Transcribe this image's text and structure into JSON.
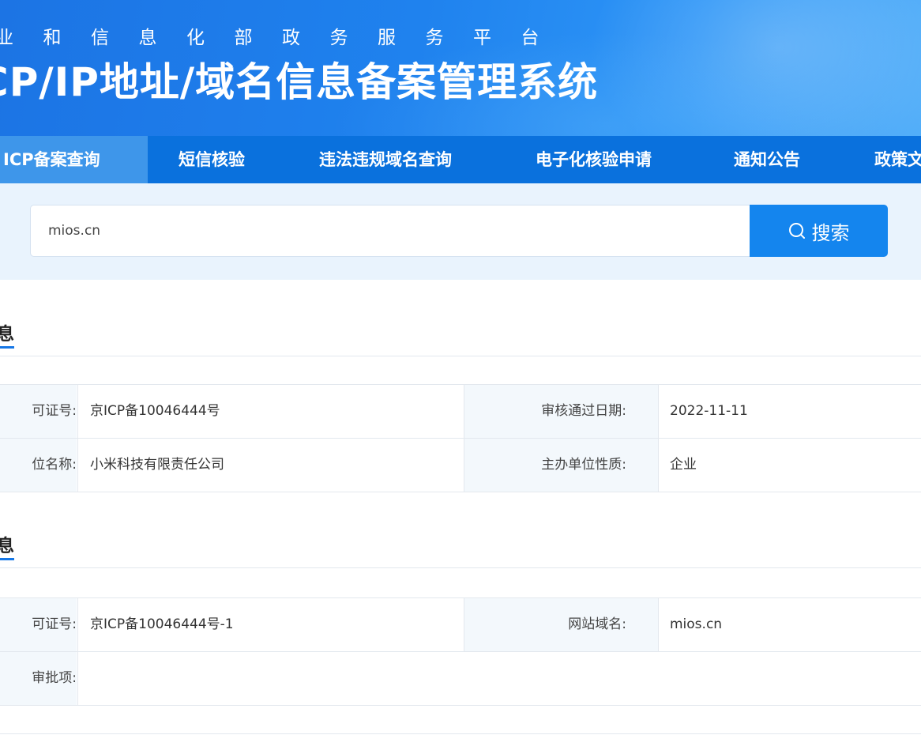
{
  "header": {
    "subtitle": "业和信息化部政务服务平台",
    "title": "CP/IP地址/域名信息备案管理系统"
  },
  "nav": {
    "tabs": [
      {
        "label": "ICP备案查询",
        "active": true
      },
      {
        "label": "短信核验"
      },
      {
        "label": "违法违规域名查询"
      },
      {
        "label": "电子化核验申请"
      },
      {
        "label": "通知公告"
      },
      {
        "label": "政策文"
      }
    ]
  },
  "search": {
    "value": "mios.cn",
    "button_label": "搜索",
    "button_icon": "search-icon"
  },
  "sections": [
    {
      "title": "息",
      "rows": [
        {
          "label1": "可证号:",
          "value1": "京ICP备10046444号",
          "label2": "审核通过日期:",
          "value2": "2022-11-11"
        },
        {
          "label1": "位名称:",
          "value1": "小米科技有限责任公司",
          "label2": "主办单位性质:",
          "value2": "企业"
        }
      ]
    },
    {
      "title": "息",
      "rows": [
        {
          "label1": "可证号:",
          "value1": "京ICP备10046444号-1",
          "label2": "网站域名:",
          "value2": "mios.cn"
        },
        {
          "label1": "审批项:",
          "value1": ""
        }
      ]
    }
  ],
  "colors": {
    "banner": "#1f82ee",
    "nav": "#0a71dd",
    "nav_active": "#3e96ea",
    "search_band": "#e9f3fd",
    "search_button": "#1485ee",
    "accent_underline": "#1677e6"
  }
}
